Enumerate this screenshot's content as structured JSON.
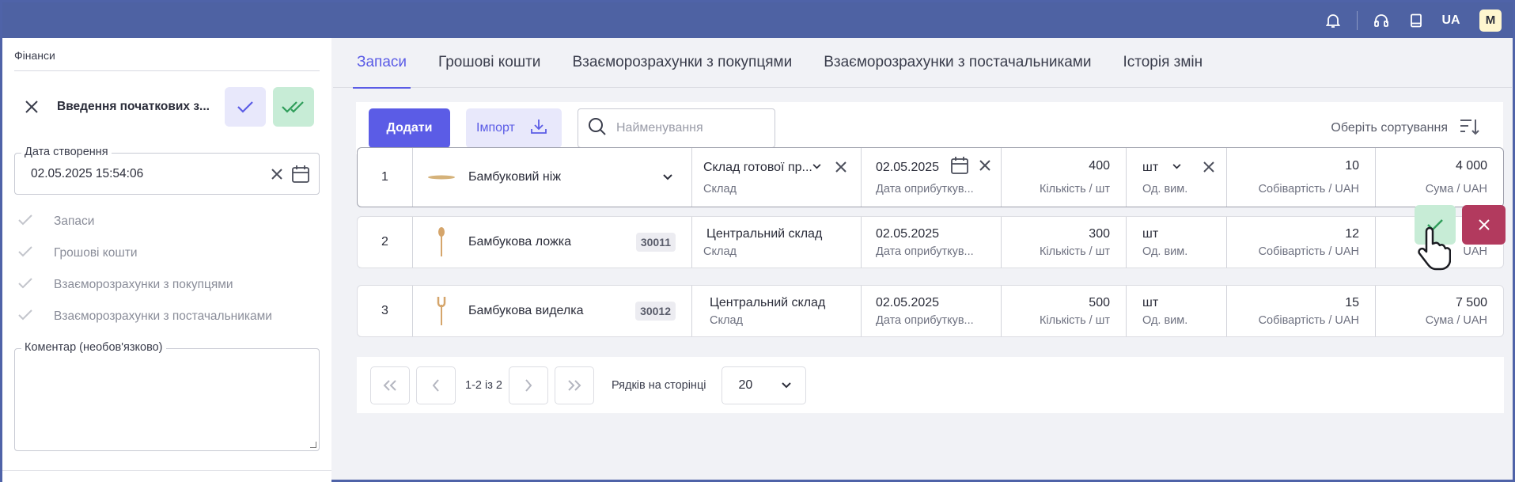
{
  "topbar": {
    "icons": [
      "bell-icon",
      "headset-icon",
      "book-icon"
    ],
    "lang": "UA",
    "avatar": "M"
  },
  "sidebar": {
    "section_title": "Фінанси",
    "doc_title": "Введення початкових з...",
    "date_legend": "Дата створення",
    "date_value": "02.05.2025 15:54:06",
    "checklist": [
      "Запаси",
      "Грошові кошти",
      "Взаєморозрахунки з покупцями",
      "Взаєморозрахунки з постачальниками"
    ],
    "comment_legend": "Коментар (необов'язково)"
  },
  "tabs": [
    {
      "label": "Запаси",
      "active": true
    },
    {
      "label": "Грошові кошти"
    },
    {
      "label": "Взаєморозрахунки з покупцями"
    },
    {
      "label": "Взаєморозрахунки з постачальниками"
    },
    {
      "label": "Історія змін"
    }
  ],
  "toolbar": {
    "add_label": "Додати",
    "import_label": "Імпорт",
    "search_placeholder": "Найменування",
    "sort_label": "Оберіть сортування"
  },
  "rows": [
    {
      "num": "1",
      "product": "Бамбуковий ніж",
      "code": "",
      "warehouse": "Склад готової пр...",
      "warehouse_label": "Склад",
      "date": "02.05.2025",
      "date_label": "Дата оприбуткув...",
      "qty": "400",
      "qty_label": "Кількість / шт",
      "unit": "шт",
      "unit_label": "Од. вим.",
      "cost": "10",
      "cost_label": "Собівартість / UAH",
      "sum": "4 000",
      "sum_label": "Сума / UAH"
    },
    {
      "num": "2",
      "product": "Бамбукова ложка",
      "code": "30011",
      "warehouse": "Центральний склад",
      "warehouse_label": "Склад",
      "date": "02.05.2025",
      "date_label": "Дата оприбуткув...",
      "qty": "300",
      "qty_label": "Кількість / шт",
      "unit": "шт",
      "unit_label": "Од. вим.",
      "cost": "12",
      "cost_label": "Собівартість / UAH",
      "sum": "",
      "sum_label": "UAH"
    },
    {
      "num": "3",
      "product": "Бамбукова виделка",
      "code": "30012",
      "warehouse": "Центральний склад",
      "warehouse_label": "Склад",
      "date": "02.05.2025",
      "date_label": "Дата оприбуткув...",
      "qty": "500",
      "qty_label": "Кількість / шт",
      "unit": "шт",
      "unit_label": "Од. вим.",
      "cost": "15",
      "cost_label": "Собівартість / UAH",
      "sum": "7 500",
      "sum_label": "Сума / UAH"
    }
  ],
  "pager": {
    "info": "1-2 із 2",
    "rows_label": "Рядків на сторінці",
    "rows_value": "20"
  },
  "colors": {
    "accent": "#5b5ce6",
    "topbar": "#4e62a3",
    "confirm": "#c7ecd6",
    "cancel": "#b23a5e"
  }
}
